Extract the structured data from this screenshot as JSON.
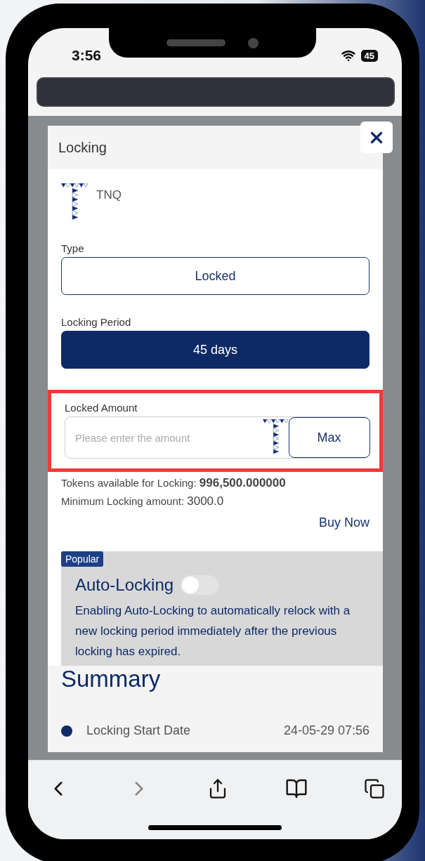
{
  "status_bar": {
    "time": "3:56",
    "battery": "45"
  },
  "modal": {
    "title": "Locking",
    "token": "TNQ",
    "fields": [
      {
        "label": "Type",
        "value": "Locked",
        "selected": false
      },
      {
        "label": "Locking Period",
        "value": "45 days",
        "selected": true
      }
    ],
    "amount": {
      "label": "Locked Amount",
      "placeholder": "Please enter the amount",
      "button": "Max",
      "highlighted": true
    },
    "available": {
      "label": "Tokens available for Locking:",
      "value": "996,500.000000"
    },
    "minimum": {
      "label": "Minimum Locking amount:",
      "value": "3000.0"
    },
    "buy_link": "Buy Now",
    "auto_locking": {
      "badge": "Popular",
      "title": "Auto-Locking",
      "on": false,
      "description": "Enabling Auto-Locking to automatically relock with a new locking period immediately after the previous locking has expired."
    },
    "summary": {
      "title": "Summary",
      "rows": [
        {
          "label": "Locking Start Date",
          "value": "24-05-29 07:56"
        }
      ]
    }
  }
}
